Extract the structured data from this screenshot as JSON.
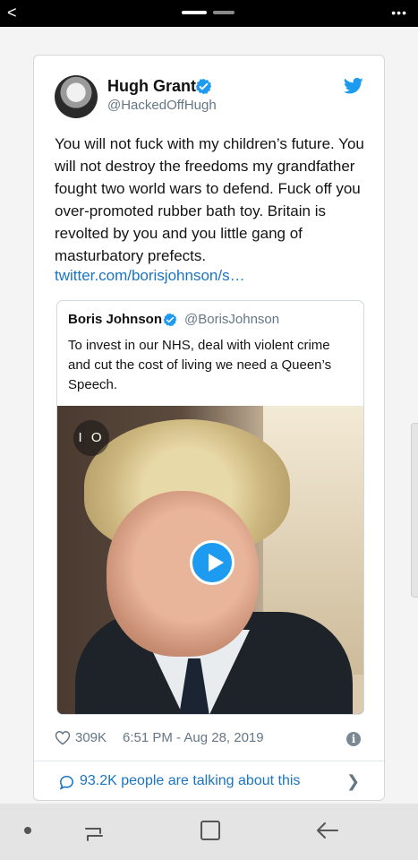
{
  "status_bar": {
    "back_glyph": "<",
    "more_glyph": "•••"
  },
  "tweet": {
    "author_name": "Hugh Grant",
    "author_handle": "@HackedOffHugh",
    "text": "You will not fuck with my children’s future. You will not destroy the freedoms my grandfather fought two world wars to defend. Fuck off you over-promoted rubber bath toy. Britain is revolted by you and you little gang of masturbatory prefects.",
    "link": "twitter.com/borisjohnson/s…",
    "likes": "309K",
    "timestamp": "6:51 PM - Aug 28, 2019",
    "conversation": "93.2K people are talking about this"
  },
  "quoted_tweet": {
    "author_name": "Boris Johnson",
    "author_handle": "@BorisJohnson",
    "text": "To invest in our NHS, deal with violent crime and cut the cost of living we need a Queen’s Speech.",
    "video_counter": "I O"
  },
  "colors": {
    "twitter_blue": "#1d9bf0",
    "link_blue": "#1b74c1",
    "muted_gray": "#657786"
  },
  "icons": [
    "back-icon",
    "more-icon",
    "verified-icon",
    "twitter-bird-icon",
    "play-icon",
    "heart-icon",
    "info-icon",
    "comment-icon",
    "chevron-right-icon",
    "recent-apps-icon",
    "home-icon",
    "nav-back-icon"
  ]
}
